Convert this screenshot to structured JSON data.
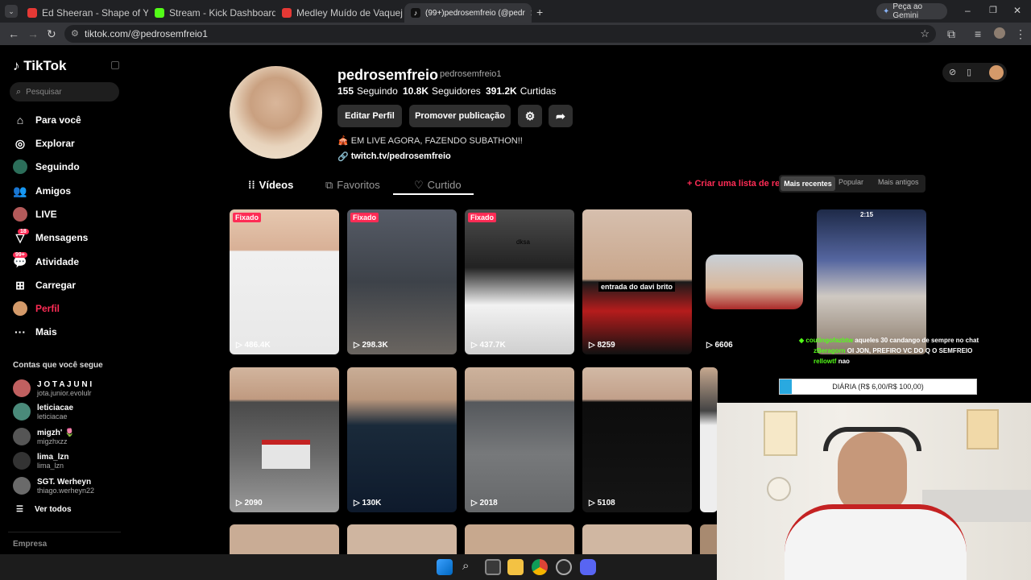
{
  "browser": {
    "tabs": [
      {
        "label": "Ed Sheeran - Shape of You 🔥 |",
        "color": "#e53935"
      },
      {
        "label": "Stream - Kick Dashboard",
        "color": "#53fc18"
      },
      {
        "label": "Medley Muído de Vaquejada - ",
        "color": "#e53935"
      },
      {
        "label": "(99+)pedrosemfreio (@pedr",
        "color": "#ffffff"
      }
    ],
    "gemini_label": "Peça ao Gemini",
    "url": "tiktok.com/@pedrosemfreio1"
  },
  "sidebar": {
    "logo": "TikTok",
    "search_placeholder": "Pesquisar",
    "nav": [
      {
        "label": "Para você",
        "icon": "home-icon"
      },
      {
        "label": "Explorar",
        "icon": "compass-icon"
      },
      {
        "label": "Seguindo",
        "icon": "following-icon"
      },
      {
        "label": "Amigos",
        "icon": "friends-icon"
      },
      {
        "label": "LIVE",
        "icon": "live-icon"
      },
      {
        "label": "Mensagens",
        "icon": "inbox-icon",
        "badge": "18"
      },
      {
        "label": "Atividade",
        "icon": "activity-icon",
        "badge": "99+"
      },
      {
        "label": "Carregar",
        "icon": "upload-icon"
      },
      {
        "label": "Perfil",
        "icon": "profile-icon"
      },
      {
        "label": "Mais",
        "icon": "more-icon"
      }
    ],
    "following_heading": "Contas que você segue",
    "accounts": [
      {
        "name": "J O T A  J U N I",
        "handle": "jota.junior.evolulr"
      },
      {
        "name": "leticiacae",
        "handle": "leticiacae"
      },
      {
        "name": "migzh' 🌷",
        "handle": "migzhxzz"
      },
      {
        "name": "lima_lzn",
        "handle": "lima_lzn"
      },
      {
        "name": "SGT. Werheyn",
        "handle": "thiago.werheyn22"
      }
    ],
    "see_all": "Ver todos",
    "company": "Empresa"
  },
  "profile": {
    "username": "pedrosemfreio",
    "handle": "pedrosemfreio1",
    "following_count": "155",
    "following_label": "Seguindo",
    "followers_count": "10.8K",
    "followers_label": "Seguidores",
    "likes_count": "391.2K",
    "likes_label": "Curtidas",
    "edit_btn": "Editar Perfil",
    "promote_btn": "Promover publicação",
    "bio": "🎪 EM LIVE AGORA, FAZENDO SUBATHON!!",
    "link": "twitch.tv/pedrosemfreio"
  },
  "tabs": {
    "videos": "Vídeos",
    "favorites": "Favoritos",
    "liked": "Curtido"
  },
  "playlist_label": "Criar uma lista de re",
  "sort": [
    "Mais recentes",
    "Popular",
    "Mais antigos"
  ],
  "videos": [
    {
      "views": "486.4K",
      "pinned": "Fixado"
    },
    {
      "views": "298.3K",
      "pinned": "Fixado"
    },
    {
      "views": "437.7K",
      "pinned": "Fixado",
      "caption": "dksa"
    },
    {
      "views": "8259",
      "caption": "entrada do davi brito"
    },
    {
      "views": "6606"
    },
    {
      "views": "",
      "caption": "2:15"
    },
    {
      "views": "2090"
    },
    {
      "views": "130K"
    },
    {
      "views": "2018"
    },
    {
      "views": "5108"
    }
  ],
  "overlay": {
    "chat": [
      {
        "user": "coutingofazbtw",
        "msg": "aqueles 30 candango de sempre no chat"
      },
      {
        "user": "zBeragorn",
        "msg": "OI JON, PREFIRO VC DO Q O SEMFREIO"
      },
      {
        "user": "rellowtf",
        "msg": "nao"
      }
    ],
    "goal": "DIÁRIA (R$ 6,00/R$ 100,00)",
    "goal_progress": 0.06
  }
}
